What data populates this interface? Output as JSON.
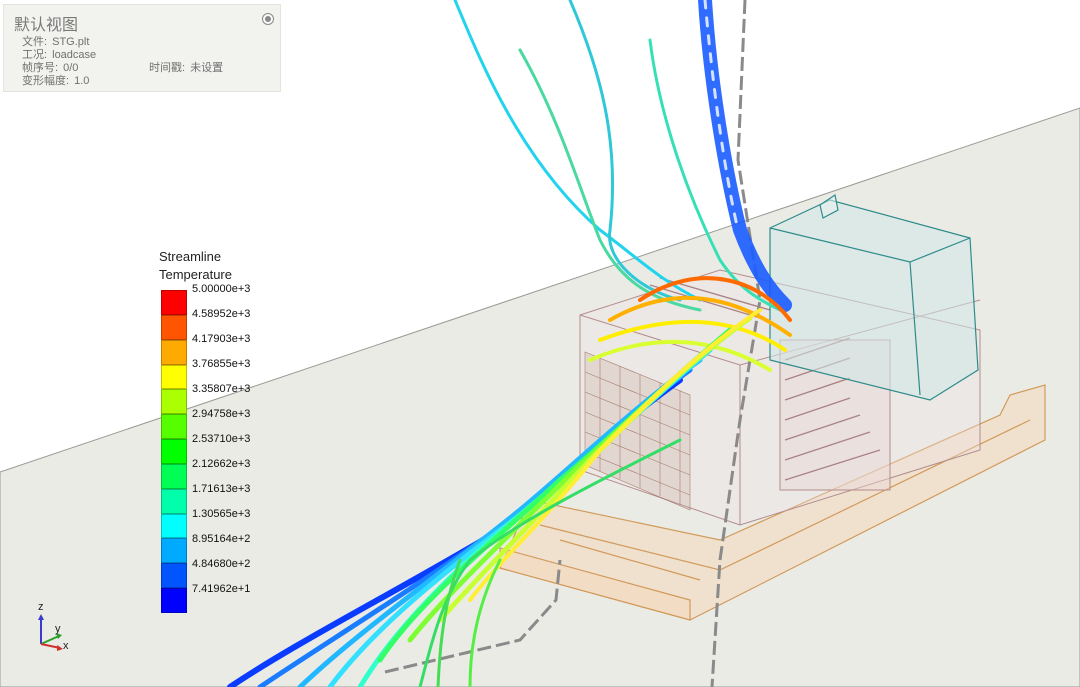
{
  "viewport": {
    "title": "默认视图",
    "file_label": "文件:",
    "file_value": "STG.plt",
    "loadcase_label": "工况:",
    "loadcase_value": "loadcase",
    "frame_label": "帧序号:",
    "frame_value": "0/0",
    "timestamp_label": "时间戳:",
    "timestamp_value": "未设置",
    "deform_label": "变形幅度:",
    "deform_value": "1.0"
  },
  "legend": {
    "title_line1": "Streamline",
    "title_line2": "Temperature",
    "colors": [
      "#ff0000",
      "#ff5500",
      "#ffaa00",
      "#ffff00",
      "#aaff00",
      "#55ff00",
      "#00ff00",
      "#00ff55",
      "#00ffaa",
      "#00ffff",
      "#00aaff",
      "#0055ff",
      "#0000ff"
    ],
    "labels": [
      "5.00000e+3",
      "4.58952e+3",
      "4.17903e+3",
      "3.76855e+3",
      "3.35807e+3",
      "2.94758e+3",
      "2.53710e+3",
      "2.12662e+3",
      "1.71613e+3",
      "1.30565e+3",
      "8.95164e+2",
      "4.84680e+2",
      "7.41962e+1"
    ]
  },
  "axes": {
    "z": "z",
    "y": "y",
    "x": "x"
  },
  "colors": {
    "floor": "#ebebe6",
    "housing_stroke": "#2e8b8b",
    "skid_stroke": "#d19a5a",
    "body_stroke": "#b48c8c"
  }
}
